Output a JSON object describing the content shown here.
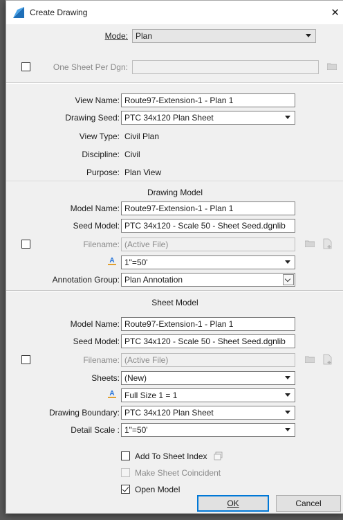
{
  "window": {
    "title": "Create Drawing"
  },
  "top": {
    "mode_label": "Mode:",
    "mode_value": "Plan",
    "one_sheet_label": "One Sheet Per Dgn:",
    "one_sheet_value": ""
  },
  "view": {
    "view_name_label": "View Name:",
    "view_name_value": "Route97-Extension-1 - Plan 1",
    "drawing_seed_label": "Drawing Seed:",
    "drawing_seed_value": "PTC 34x120 Plan Sheet",
    "view_type_label": "View Type:",
    "view_type_value": "Civil Plan",
    "discipline_label": "Discipline:",
    "discipline_value": "Civil",
    "purpose_label": "Purpose:",
    "purpose_value": "Plan View"
  },
  "drawing_model": {
    "section_title": "Drawing Model",
    "model_name_label": "Model Name:",
    "model_name_value": "Route97-Extension-1 - Plan 1",
    "seed_model_label": "Seed Model:",
    "seed_model_value": "PTC 34x120 - Scale 50 - Sheet Seed.dgnlib",
    "filename_label": "Filename:",
    "filename_value": "(Active File)",
    "scale_value": "1\"=50'",
    "annotation_group_label": "Annotation Group:",
    "annotation_group_value": "Plan Annotation"
  },
  "sheet_model": {
    "section_title": "Sheet Model",
    "model_name_label": "Model Name:",
    "model_name_value": "Route97-Extension-1 - Plan 1",
    "seed_model_label": "Seed Model:",
    "seed_model_value": "PTC 34x120 - Scale 50 - Sheet Seed.dgnlib",
    "filename_label": "Filename:",
    "filename_value": "(Active File)",
    "sheets_label": "Sheets:",
    "sheets_value": "(New)",
    "scale_value": "Full Size 1 = 1",
    "drawing_boundary_label": "Drawing Boundary:",
    "drawing_boundary_value": "PTC 34x120 Plan Sheet",
    "detail_scale_label": "Detail Scale :",
    "detail_scale_value": "1\"=50'"
  },
  "options": {
    "add_to_sheet_index_label": "Add To Sheet Index",
    "add_to_sheet_index_checked": false,
    "make_sheet_coincident_label": "Make Sheet Coincident",
    "open_model_label": "Open Model",
    "open_model_checked": true
  },
  "buttons": {
    "ok_label": "OK",
    "cancel_label": "Cancel"
  },
  "colors": {
    "accent": "#0078d7",
    "disabled_text": "#8a8a8a",
    "window_bg": "#f0f0f0",
    "scale_icon": "#1e6fd9"
  }
}
